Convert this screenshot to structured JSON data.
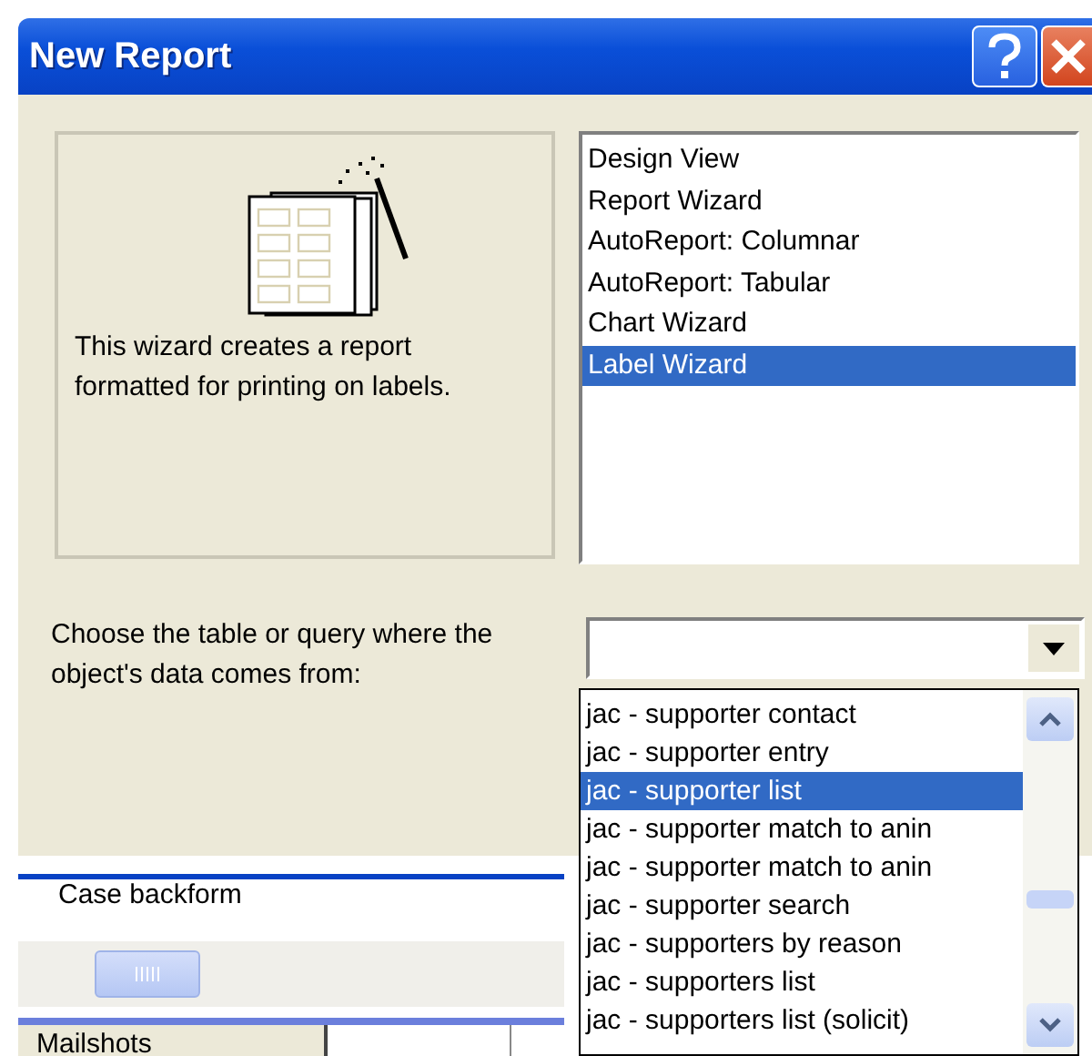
{
  "window": {
    "title": "New Report"
  },
  "description": "This wizard creates a report formatted for printing on labels.",
  "report_types": [
    {
      "label": "Design View",
      "selected": false
    },
    {
      "label": "Report Wizard",
      "selected": false
    },
    {
      "label": "AutoReport:  Columnar",
      "selected": false
    },
    {
      "label": "AutoReport:  Tabular",
      "selected": false
    },
    {
      "label": "Chart Wizard",
      "selected": false
    },
    {
      "label": "Label Wizard",
      "selected": true
    }
  ],
  "source": {
    "label": "Choose the table or query where the object's data comes from:"
  },
  "source_options": [
    {
      "label": "jac - supporter contact",
      "selected": false
    },
    {
      "label": "jac - supporter entry",
      "selected": false
    },
    {
      "label": "jac - supporter list",
      "selected": true
    },
    {
      "label": "jac - supporter match to anin",
      "selected": false
    },
    {
      "label": "jac - supporter match to anin",
      "selected": false
    },
    {
      "label": "jac - supporter search",
      "selected": false
    },
    {
      "label": "jac - supporters by reason",
      "selected": false
    },
    {
      "label": "jac - supporters list",
      "selected": false
    },
    {
      "label": "jac - supporters list (solicit)",
      "selected": false
    }
  ],
  "background_window": {
    "row_text": "Case backform",
    "tab": "Mailshots"
  }
}
